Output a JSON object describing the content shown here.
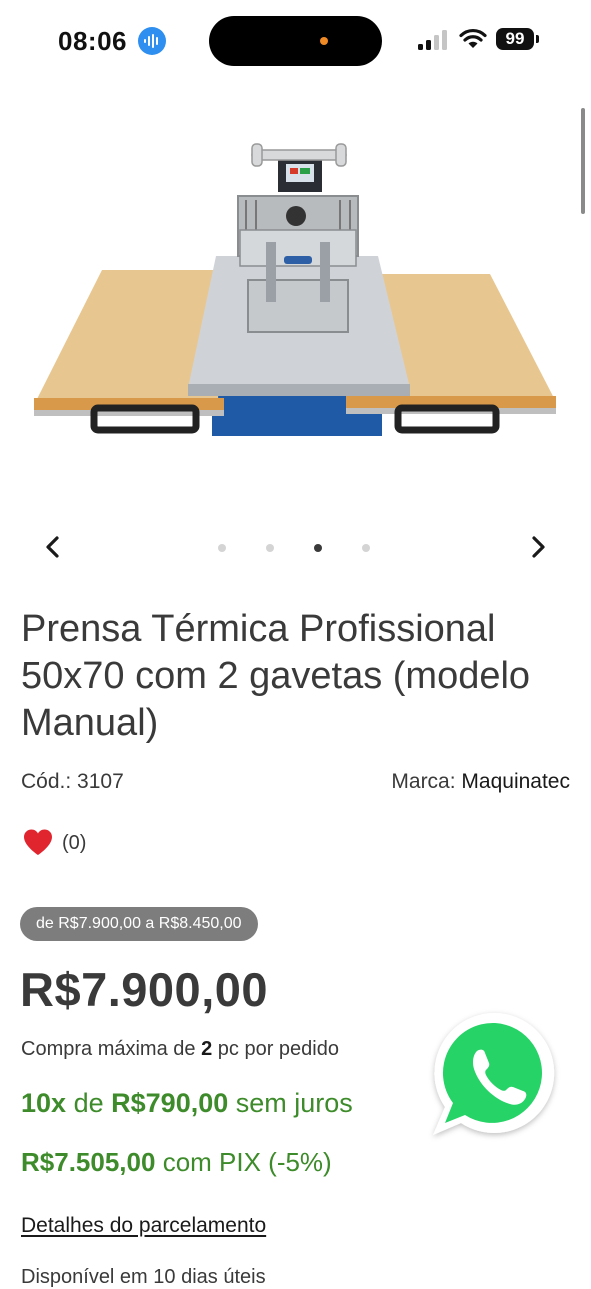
{
  "status_bar": {
    "time": "08:06",
    "battery": "99",
    "icons": [
      "audio-wave-icon",
      "signal-icon",
      "wifi-icon",
      "battery-icon"
    ]
  },
  "carousel": {
    "total_dots": 4,
    "active_index": 2,
    "prev_icon": "chevron-left-icon",
    "next_icon": "chevron-right-icon"
  },
  "product": {
    "title": "Prensa Térmica Profissional 50x70 com 2 gavetas (modelo Manual)",
    "code_label": "Cód.:",
    "code": "3107",
    "brand_label": "Marca:",
    "brand": "Maquinatec",
    "reviews": "(0)",
    "price_range": "de R$7.900,00 a R$8.450,00",
    "price": "R$7.900,00",
    "max_buy_prefix": "Compra máxima de",
    "max_buy_qty": "2",
    "max_buy_suffix": "pc por pedido",
    "installment_count": "10x",
    "installment_de": "de",
    "installment_value": "R$790,00",
    "installment_suffix": "sem juros",
    "pix_price": "R$7.505,00",
    "pix_suffix": "com PIX (-5%)",
    "details_link": "Detalhes do parcelamento",
    "availability": "Disponível em 10 dias úteis"
  },
  "colors": {
    "green": "#3d8b2a",
    "badge_gray": "#7d7d7d",
    "heart": "#e0252e",
    "whatsapp": "#25d366"
  }
}
